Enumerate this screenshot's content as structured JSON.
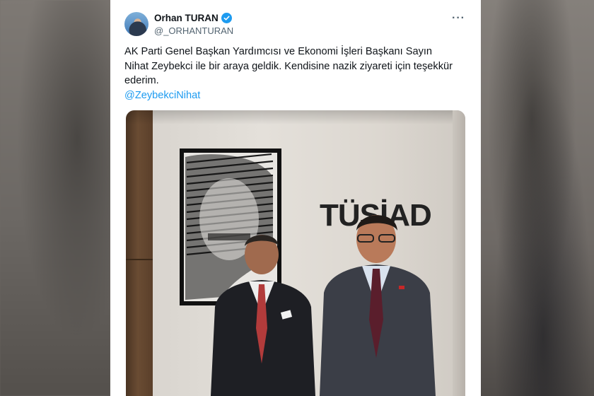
{
  "tweet": {
    "author_name": "Orhan TURAN",
    "handle": "@_ORHANTURAN",
    "text": "AK Parti Genel Başkan Yardımcısı ve Ekonomi İşleri Başkanı Sayın Nihat Zeybekci ile bir araya geldik. Kendisine nazik ziyareti için teşekkür ederim.",
    "mention": "@ZeybekciNihat",
    "more_icon": "more-options-icon",
    "verified_icon": "verified-badge-icon"
  },
  "photo": {
    "sign_text": "TÜSİAD"
  },
  "colors": {
    "accent": "#1d9bf0",
    "text": "#0f1419",
    "secondary": "#536471"
  }
}
